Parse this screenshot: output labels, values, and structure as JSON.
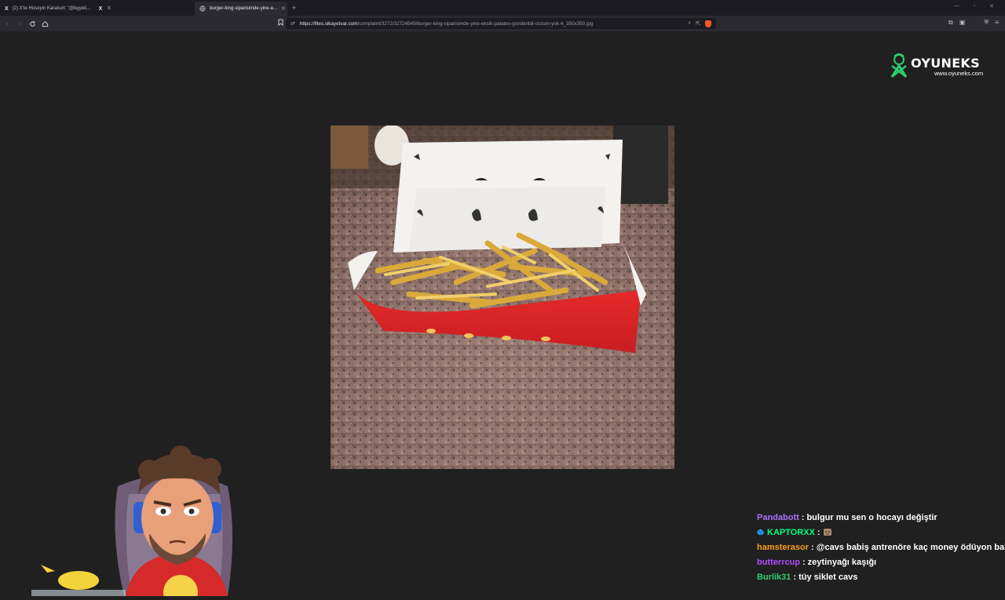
{
  "browser": {
    "tabs": [
      {
        "label": "(2) X'te Hüseyin Karakurt: \"@bgyeti...",
        "icon": "x-logo-icon",
        "active": false
      },
      {
        "label": "X",
        "icon": "x-logo-icon",
        "active": false
      },
      {
        "label": "burger-king-siparisimde-yine-e...",
        "icon": "globe-icon",
        "active": true
      }
    ],
    "new_tab": "+",
    "url_host": "https://files.sikayetvar.com",
    "url_path": "/complaint/3272/32724549/burger-king-siparisimde-yine-eksik-patates-gonderildi-cozum-yok-4_350x350.jpg"
  },
  "overlay": {
    "logo_name": "OYUNEKS",
    "logo_url": "www.oyuneks.com",
    "accent_color": "#2ecc71"
  },
  "image": {
    "subject": "fries-box-photo"
  },
  "chat": [
    {
      "user": "Pandabott",
      "color": "#a970ff",
      "badge": "",
      "text": "bulgur mu sen o hocayı değiştir"
    },
    {
      "user": "KAPTORXX",
      "color": "#00ff7f",
      "badge": "cube-badge-icon",
      "text": ""
    },
    {
      "user": "hamsterasor",
      "color": "#ff9f1a",
      "badge": "",
      "text": "@cavs babiş antrenöre kaç money ödüyon babiş"
    },
    {
      "user": "butterrcup",
      "color": "#b04bff",
      "badge": "",
      "text": "zeytinyağı kaşığı"
    },
    {
      "user": "Burlik31",
      "color": "#2ecc71",
      "badge": "",
      "text": "tüy siklet cavs"
    }
  ]
}
